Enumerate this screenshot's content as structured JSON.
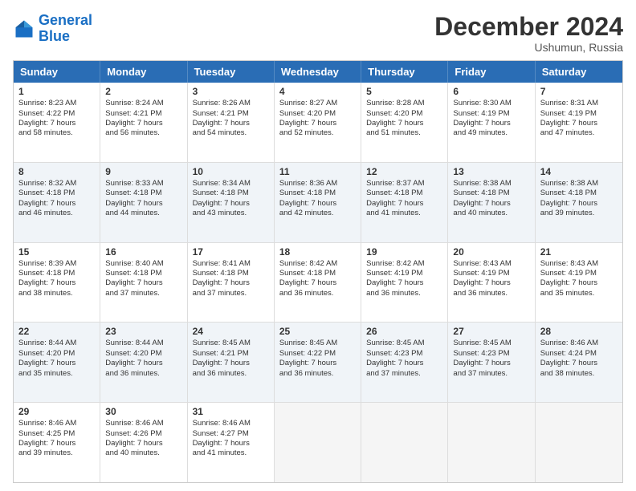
{
  "logo": {
    "line1": "General",
    "line2": "Blue"
  },
  "title": "December 2024",
  "location": "Ushumun, Russia",
  "header_days": [
    "Sunday",
    "Monday",
    "Tuesday",
    "Wednesday",
    "Thursday",
    "Friday",
    "Saturday"
  ],
  "rows": [
    [
      {
        "day": "1",
        "lines": [
          "Sunrise: 8:23 AM",
          "Sunset: 4:22 PM",
          "Daylight: 7 hours",
          "and 58 minutes."
        ]
      },
      {
        "day": "2",
        "lines": [
          "Sunrise: 8:24 AM",
          "Sunset: 4:21 PM",
          "Daylight: 7 hours",
          "and 56 minutes."
        ]
      },
      {
        "day": "3",
        "lines": [
          "Sunrise: 8:26 AM",
          "Sunset: 4:21 PM",
          "Daylight: 7 hours",
          "and 54 minutes."
        ]
      },
      {
        "day": "4",
        "lines": [
          "Sunrise: 8:27 AM",
          "Sunset: 4:20 PM",
          "Daylight: 7 hours",
          "and 52 minutes."
        ]
      },
      {
        "day": "5",
        "lines": [
          "Sunrise: 8:28 AM",
          "Sunset: 4:20 PM",
          "Daylight: 7 hours",
          "and 51 minutes."
        ]
      },
      {
        "day": "6",
        "lines": [
          "Sunrise: 8:30 AM",
          "Sunset: 4:19 PM",
          "Daylight: 7 hours",
          "and 49 minutes."
        ]
      },
      {
        "day": "7",
        "lines": [
          "Sunrise: 8:31 AM",
          "Sunset: 4:19 PM",
          "Daylight: 7 hours",
          "and 47 minutes."
        ]
      }
    ],
    [
      {
        "day": "8",
        "lines": [
          "Sunrise: 8:32 AM",
          "Sunset: 4:18 PM",
          "Daylight: 7 hours",
          "and 46 minutes."
        ]
      },
      {
        "day": "9",
        "lines": [
          "Sunrise: 8:33 AM",
          "Sunset: 4:18 PM",
          "Daylight: 7 hours",
          "and 44 minutes."
        ]
      },
      {
        "day": "10",
        "lines": [
          "Sunrise: 8:34 AM",
          "Sunset: 4:18 PM",
          "Daylight: 7 hours",
          "and 43 minutes."
        ]
      },
      {
        "day": "11",
        "lines": [
          "Sunrise: 8:36 AM",
          "Sunset: 4:18 PM",
          "Daylight: 7 hours",
          "and 42 minutes."
        ]
      },
      {
        "day": "12",
        "lines": [
          "Sunrise: 8:37 AM",
          "Sunset: 4:18 PM",
          "Daylight: 7 hours",
          "and 41 minutes."
        ]
      },
      {
        "day": "13",
        "lines": [
          "Sunrise: 8:38 AM",
          "Sunset: 4:18 PM",
          "Daylight: 7 hours",
          "and 40 minutes."
        ]
      },
      {
        "day": "14",
        "lines": [
          "Sunrise: 8:38 AM",
          "Sunset: 4:18 PM",
          "Daylight: 7 hours",
          "and 39 minutes."
        ]
      }
    ],
    [
      {
        "day": "15",
        "lines": [
          "Sunrise: 8:39 AM",
          "Sunset: 4:18 PM",
          "Daylight: 7 hours",
          "and 38 minutes."
        ]
      },
      {
        "day": "16",
        "lines": [
          "Sunrise: 8:40 AM",
          "Sunset: 4:18 PM",
          "Daylight: 7 hours",
          "and 37 minutes."
        ]
      },
      {
        "day": "17",
        "lines": [
          "Sunrise: 8:41 AM",
          "Sunset: 4:18 PM",
          "Daylight: 7 hours",
          "and 37 minutes."
        ]
      },
      {
        "day": "18",
        "lines": [
          "Sunrise: 8:42 AM",
          "Sunset: 4:18 PM",
          "Daylight: 7 hours",
          "and 36 minutes."
        ]
      },
      {
        "day": "19",
        "lines": [
          "Sunrise: 8:42 AM",
          "Sunset: 4:19 PM",
          "Daylight: 7 hours",
          "and 36 minutes."
        ]
      },
      {
        "day": "20",
        "lines": [
          "Sunrise: 8:43 AM",
          "Sunset: 4:19 PM",
          "Daylight: 7 hours",
          "and 36 minutes."
        ]
      },
      {
        "day": "21",
        "lines": [
          "Sunrise: 8:43 AM",
          "Sunset: 4:19 PM",
          "Daylight: 7 hours",
          "and 35 minutes."
        ]
      }
    ],
    [
      {
        "day": "22",
        "lines": [
          "Sunrise: 8:44 AM",
          "Sunset: 4:20 PM",
          "Daylight: 7 hours",
          "and 35 minutes."
        ]
      },
      {
        "day": "23",
        "lines": [
          "Sunrise: 8:44 AM",
          "Sunset: 4:20 PM",
          "Daylight: 7 hours",
          "and 36 minutes."
        ]
      },
      {
        "day": "24",
        "lines": [
          "Sunrise: 8:45 AM",
          "Sunset: 4:21 PM",
          "Daylight: 7 hours",
          "and 36 minutes."
        ]
      },
      {
        "day": "25",
        "lines": [
          "Sunrise: 8:45 AM",
          "Sunset: 4:22 PM",
          "Daylight: 7 hours",
          "and 36 minutes."
        ]
      },
      {
        "day": "26",
        "lines": [
          "Sunrise: 8:45 AM",
          "Sunset: 4:23 PM",
          "Daylight: 7 hours",
          "and 37 minutes."
        ]
      },
      {
        "day": "27",
        "lines": [
          "Sunrise: 8:45 AM",
          "Sunset: 4:23 PM",
          "Daylight: 7 hours",
          "and 37 minutes."
        ]
      },
      {
        "day": "28",
        "lines": [
          "Sunrise: 8:46 AM",
          "Sunset: 4:24 PM",
          "Daylight: 7 hours",
          "and 38 minutes."
        ]
      }
    ],
    [
      {
        "day": "29",
        "lines": [
          "Sunrise: 8:46 AM",
          "Sunset: 4:25 PM",
          "Daylight: 7 hours",
          "and 39 minutes."
        ]
      },
      {
        "day": "30",
        "lines": [
          "Sunrise: 8:46 AM",
          "Sunset: 4:26 PM",
          "Daylight: 7 hours",
          "and 40 minutes."
        ]
      },
      {
        "day": "31",
        "lines": [
          "Sunrise: 8:46 AM",
          "Sunset: 4:27 PM",
          "Daylight: 7 hours",
          "and 41 minutes."
        ]
      },
      null,
      null,
      null,
      null
    ]
  ]
}
